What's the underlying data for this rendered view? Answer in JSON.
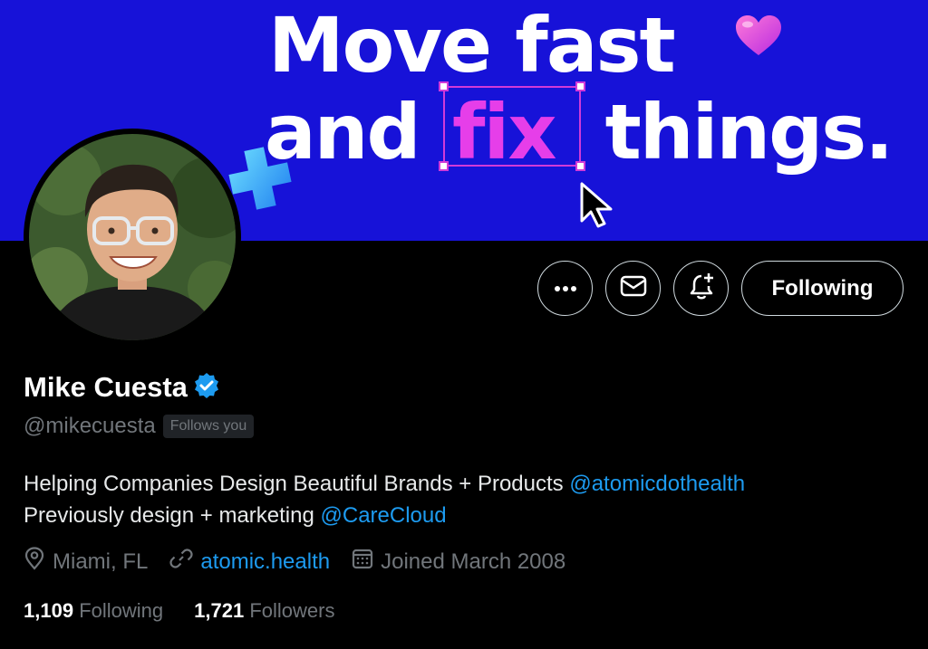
{
  "banner": {
    "line1": "Move fast",
    "line2_prefix": "and",
    "line2_highlight": "fix",
    "line2_suffix": "things."
  },
  "profile": {
    "name": "Mike Cuesta",
    "handle": "@mikecuesta",
    "follows_you": "Follows you",
    "bio_line1_text": "Helping Companies Design Beautiful Brands + Products ",
    "bio_line1_link": "@atomicdothealth",
    "bio_line2_text": "Previously design + marketing ",
    "bio_line2_link": "@CareCloud",
    "location": "Miami, FL",
    "website": "atomic.health",
    "joined": "Joined March 2008"
  },
  "actions": {
    "follow_label": "Following"
  },
  "stats": {
    "following_count": "1,109",
    "following_label": "Following",
    "followers_count": "1,721",
    "followers_label": "Followers"
  },
  "colors": {
    "banner_bg": "#1712d8",
    "highlight": "#e63ee9",
    "link": "#1d9bf0",
    "muted": "#71767b"
  }
}
